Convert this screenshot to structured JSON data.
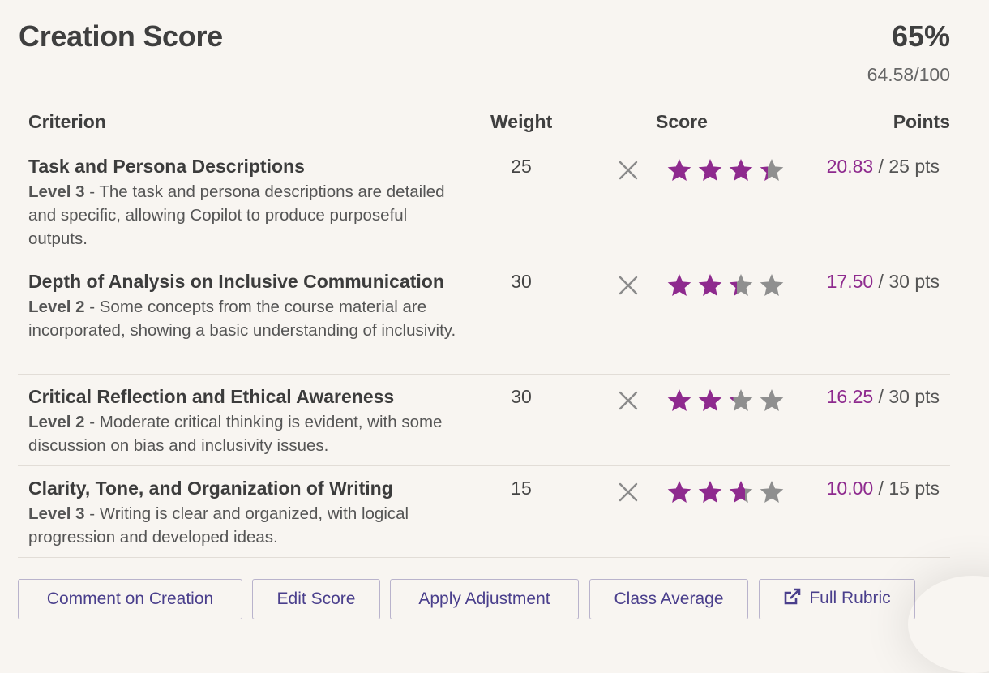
{
  "header": {
    "title": "Creation Score",
    "percent": "65%",
    "raw_score": "64.58/100"
  },
  "table": {
    "columns": [
      "Criterion",
      "Weight",
      "Score",
      "Points"
    ],
    "rows": [
      {
        "name": "Task and Persona Descriptions",
        "level": "Level 3",
        "description": " - The task and persona descriptions are detailed and specific, allowing Copilot to produce purposeful outputs.",
        "weight": "25",
        "stars_filled": 3.33,
        "stars_total": 4,
        "earned": "20.83",
        "possible": " / 25 pts"
      },
      {
        "name": "Depth of Analysis on Inclusive Communication",
        "level": "Level 2",
        "description": " - Some concepts from the course material are incorporated, showing a basic understanding of inclusivity.",
        "weight": "30",
        "stars_filled": 2.33,
        "stars_total": 4,
        "earned": "17.50",
        "possible": " / 30 pts"
      },
      {
        "name": "Critical Reflection and Ethical Awareness",
        "level": "Level 2",
        "description": " - Moderate critical thinking is evident, with some discussion on bias and inclusivity issues.",
        "weight": "30",
        "stars_filled": 2.17,
        "stars_total": 4,
        "earned": "16.25",
        "possible": " / 30 pts"
      },
      {
        "name": "Clarity, Tone, and Organization of Writing",
        "level": "Level 3",
        "description": " - Writing is clear and organized, with logical progression and developed ideas.",
        "weight": "15",
        "stars_filled": 2.67,
        "stars_total": 4,
        "earned": "10.00",
        "possible": " / 15 pts"
      }
    ]
  },
  "actions": {
    "comment": "Comment on Creation",
    "edit": "Edit Score",
    "adjust": "Apply Adjustment",
    "average": "Class Average",
    "rubric": "Full Rubric",
    "rubric_icon": "external-link-icon"
  },
  "colors": {
    "accent": "#8e2a8e",
    "star_empty": "#8f8f8f",
    "button_text": "#4a3f8c",
    "background": "#f8f5f1"
  }
}
